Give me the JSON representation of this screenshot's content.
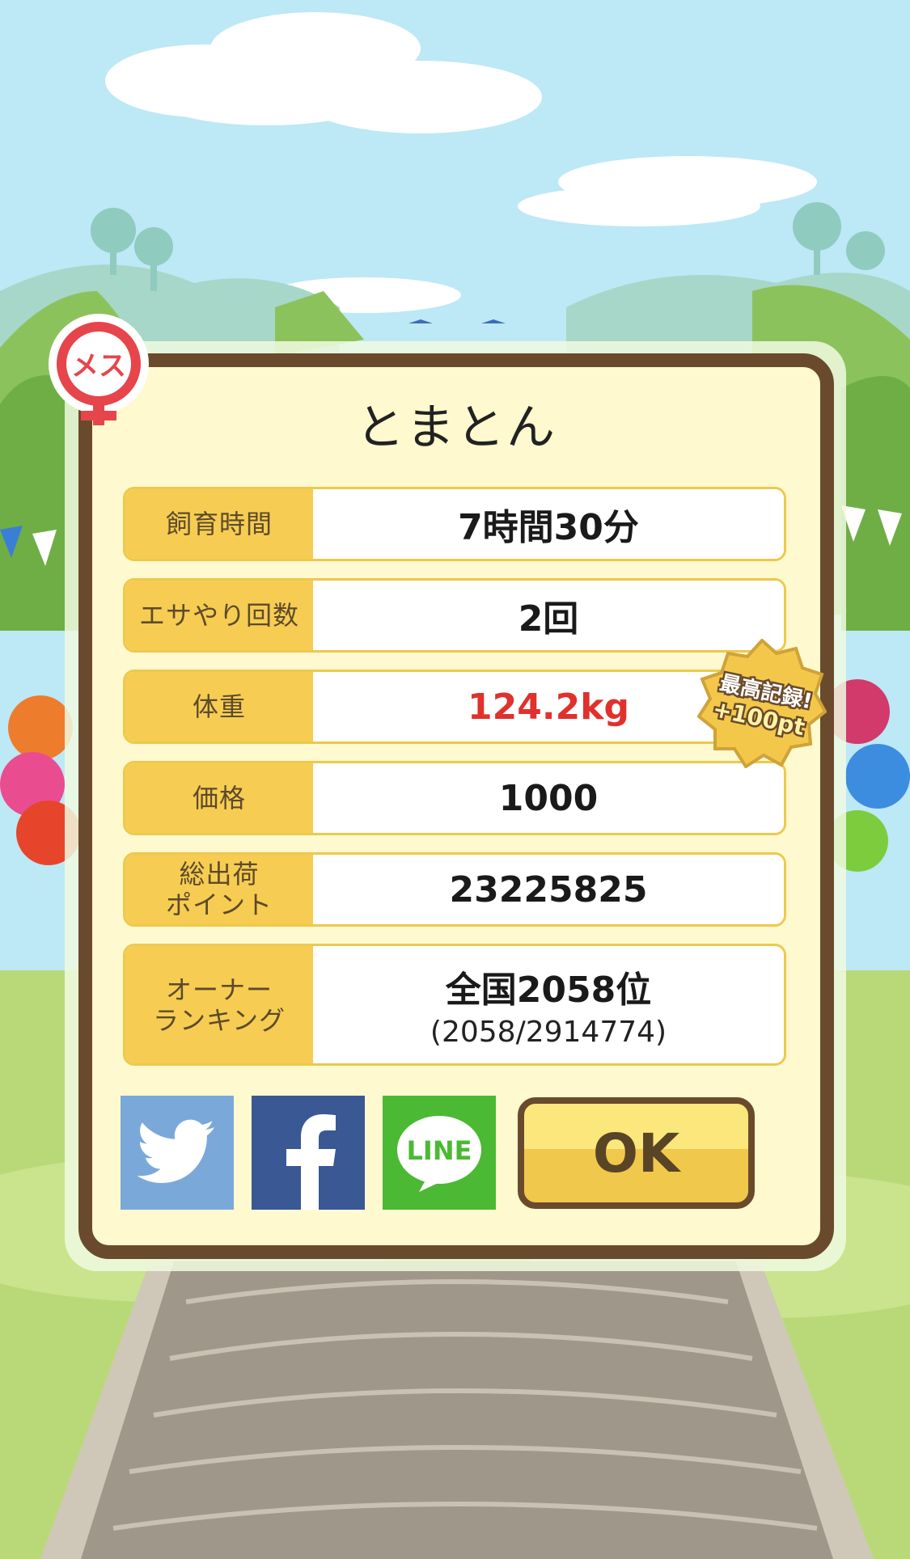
{
  "pet": {
    "name": "とまとん",
    "gender_badge": "メス",
    "gender_icon": "female-symbol"
  },
  "stats": [
    {
      "label": "飼育時間",
      "value": "7時間30分"
    },
    {
      "label": "エサやり回数",
      "value": "2回"
    },
    {
      "label": "体重",
      "value": "124.2kg",
      "highlight_color": "#e0312d"
    },
    {
      "label": "価格",
      "value": "1000"
    },
    {
      "label": "総出荷\nポイント",
      "value": "23225825"
    },
    {
      "label": "オーナー\nランキング",
      "value": "全国2058位",
      "sub": "(2058/2914774)"
    }
  ],
  "record_badge": {
    "line1": "最高記録!",
    "line2": "+100pt"
  },
  "share": {
    "twitter_icon": "twitter-bird",
    "facebook_icon": "facebook-f",
    "line_text": "LINE"
  },
  "ok_label": "OK",
  "colors": {
    "dialog_border": "#6a4a2d",
    "label_bg": "#f6cd52",
    "ok_top": "#fbe77b",
    "ok_bottom": "#f0c84b"
  }
}
